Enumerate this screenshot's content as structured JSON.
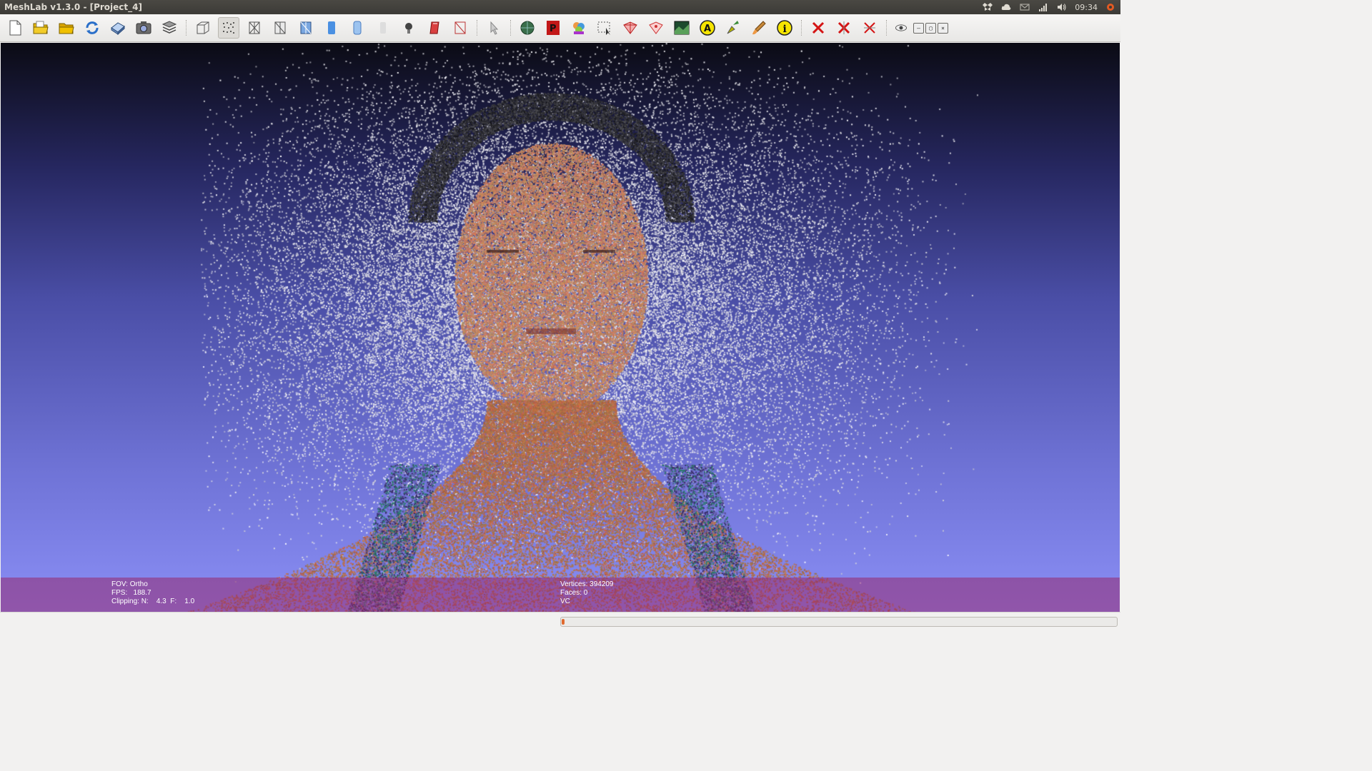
{
  "window": {
    "title": "MeshLab v1.3.0 - [Project_4]"
  },
  "tray": {
    "icons": [
      "dropbox-icon",
      "cloud-icon",
      "mail-icon",
      "network-signal-icon",
      "volume-icon"
    ],
    "clock": "09:34",
    "session_icon": "power-gear-icon"
  },
  "toolbar": {
    "file_group": [
      "new-project-icon",
      "open-project-icon",
      "import-mesh-icon",
      "reload-icon",
      "export-mesh-icon",
      "snapshot-icon",
      "layers-icon"
    ],
    "render_group": [
      "bounding-box-icon",
      "points-icon",
      "wireframe-icon",
      "hidden-lines-icon",
      "flat-lines-icon",
      "flat-icon",
      "smooth-icon",
      "texture-icon",
      "light-icon",
      "double-side-icon",
      "back-face-icon"
    ],
    "tool_group": [
      "select-icon"
    ],
    "filter_group": [
      "sphere-icon",
      "pdf-icon",
      "color-paint-icon",
      "select-area-icon",
      "edit-face-icon",
      "edit-vertex-icon",
      "raster-icon",
      "align-icon",
      "pick-points-icon",
      "paint-brush-icon",
      "info-icon"
    ],
    "delete_group": [
      "delete-vertex-icon",
      "delete-face-icon",
      "delete-both-icon"
    ],
    "window_controls": [
      "eye-icon",
      "minimize-icon",
      "restore-icon",
      "close-icon"
    ],
    "mini_labels": [
      "–",
      "▢",
      "×"
    ]
  },
  "viewport": {
    "left_info": [
      "FOV: Ortho",
      "FPS:   188.7",
      "Clipping: N:    4.3  F:    1.0"
    ],
    "right_info": [
      "Vertices: 394209",
      "Faces: 0",
      "VC"
    ]
  },
  "status": {
    "progress": 0.005
  },
  "colors": {
    "accent": "#e06a2f",
    "info_bar": "#962a6e",
    "bg_top": "#0b0b14",
    "bg_bottom": "#8a8ef5"
  }
}
